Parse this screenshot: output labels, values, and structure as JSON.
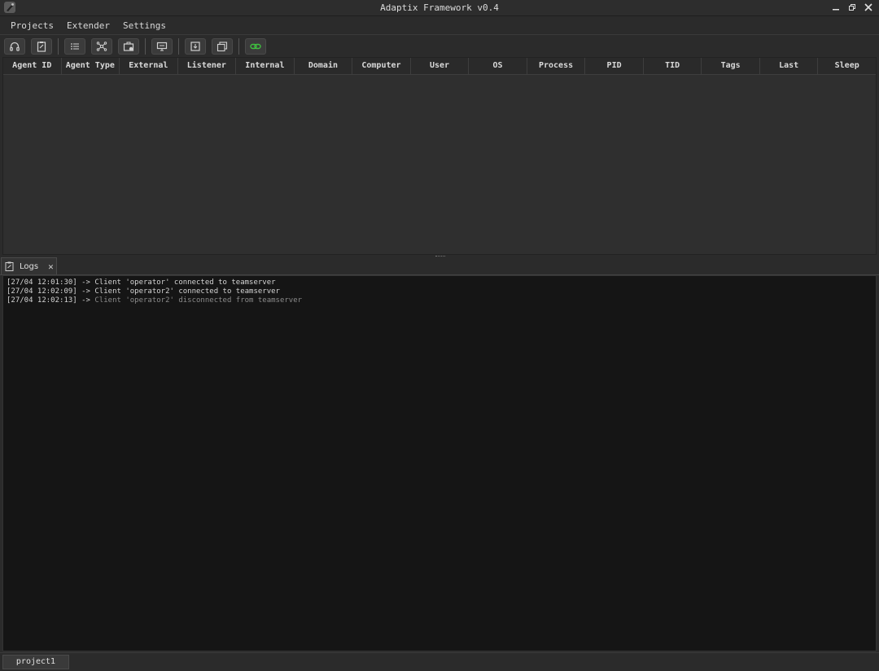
{
  "window": {
    "title": "Adaptix Framework v0.4",
    "controls": [
      "minimize-icon",
      "restore-icon",
      "close-icon"
    ]
  },
  "menu": {
    "items": [
      "Projects",
      "Extender",
      "Settings"
    ]
  },
  "toolbar": {
    "buttons": [
      "headphones-icon",
      "clipboard-icon",
      "list-icon",
      "network-icon",
      "briefcase-icon",
      "monitor-icon",
      "download-icon",
      "screenshot-icon",
      "link-icon"
    ],
    "accent": "#3fbf3f"
  },
  "agents_table": {
    "columns": [
      "Agent ID",
      "Agent Type",
      "External",
      "Listener",
      "Internal",
      "Domain",
      "Computer",
      "User",
      "OS",
      "Process",
      "PID",
      "TID",
      "Tags",
      "Last",
      "Sleep"
    ],
    "rows": []
  },
  "logs_tab": {
    "label": "Logs",
    "close": "✕"
  },
  "logs": [
    {
      "time": "[27/04 12:01:30]",
      "arrow": "->",
      "msg": "Client 'operator' connected to teamserver"
    },
    {
      "time": "[27/04 12:02:09]",
      "arrow": "->",
      "msg": "Client 'operator2' connected to teamserver"
    },
    {
      "time": "[27/04 12:02:13]",
      "arrow": "->",
      "msg": "Client 'operator2' disconnected from teamserver"
    }
  ],
  "status": {
    "project": "project1"
  }
}
